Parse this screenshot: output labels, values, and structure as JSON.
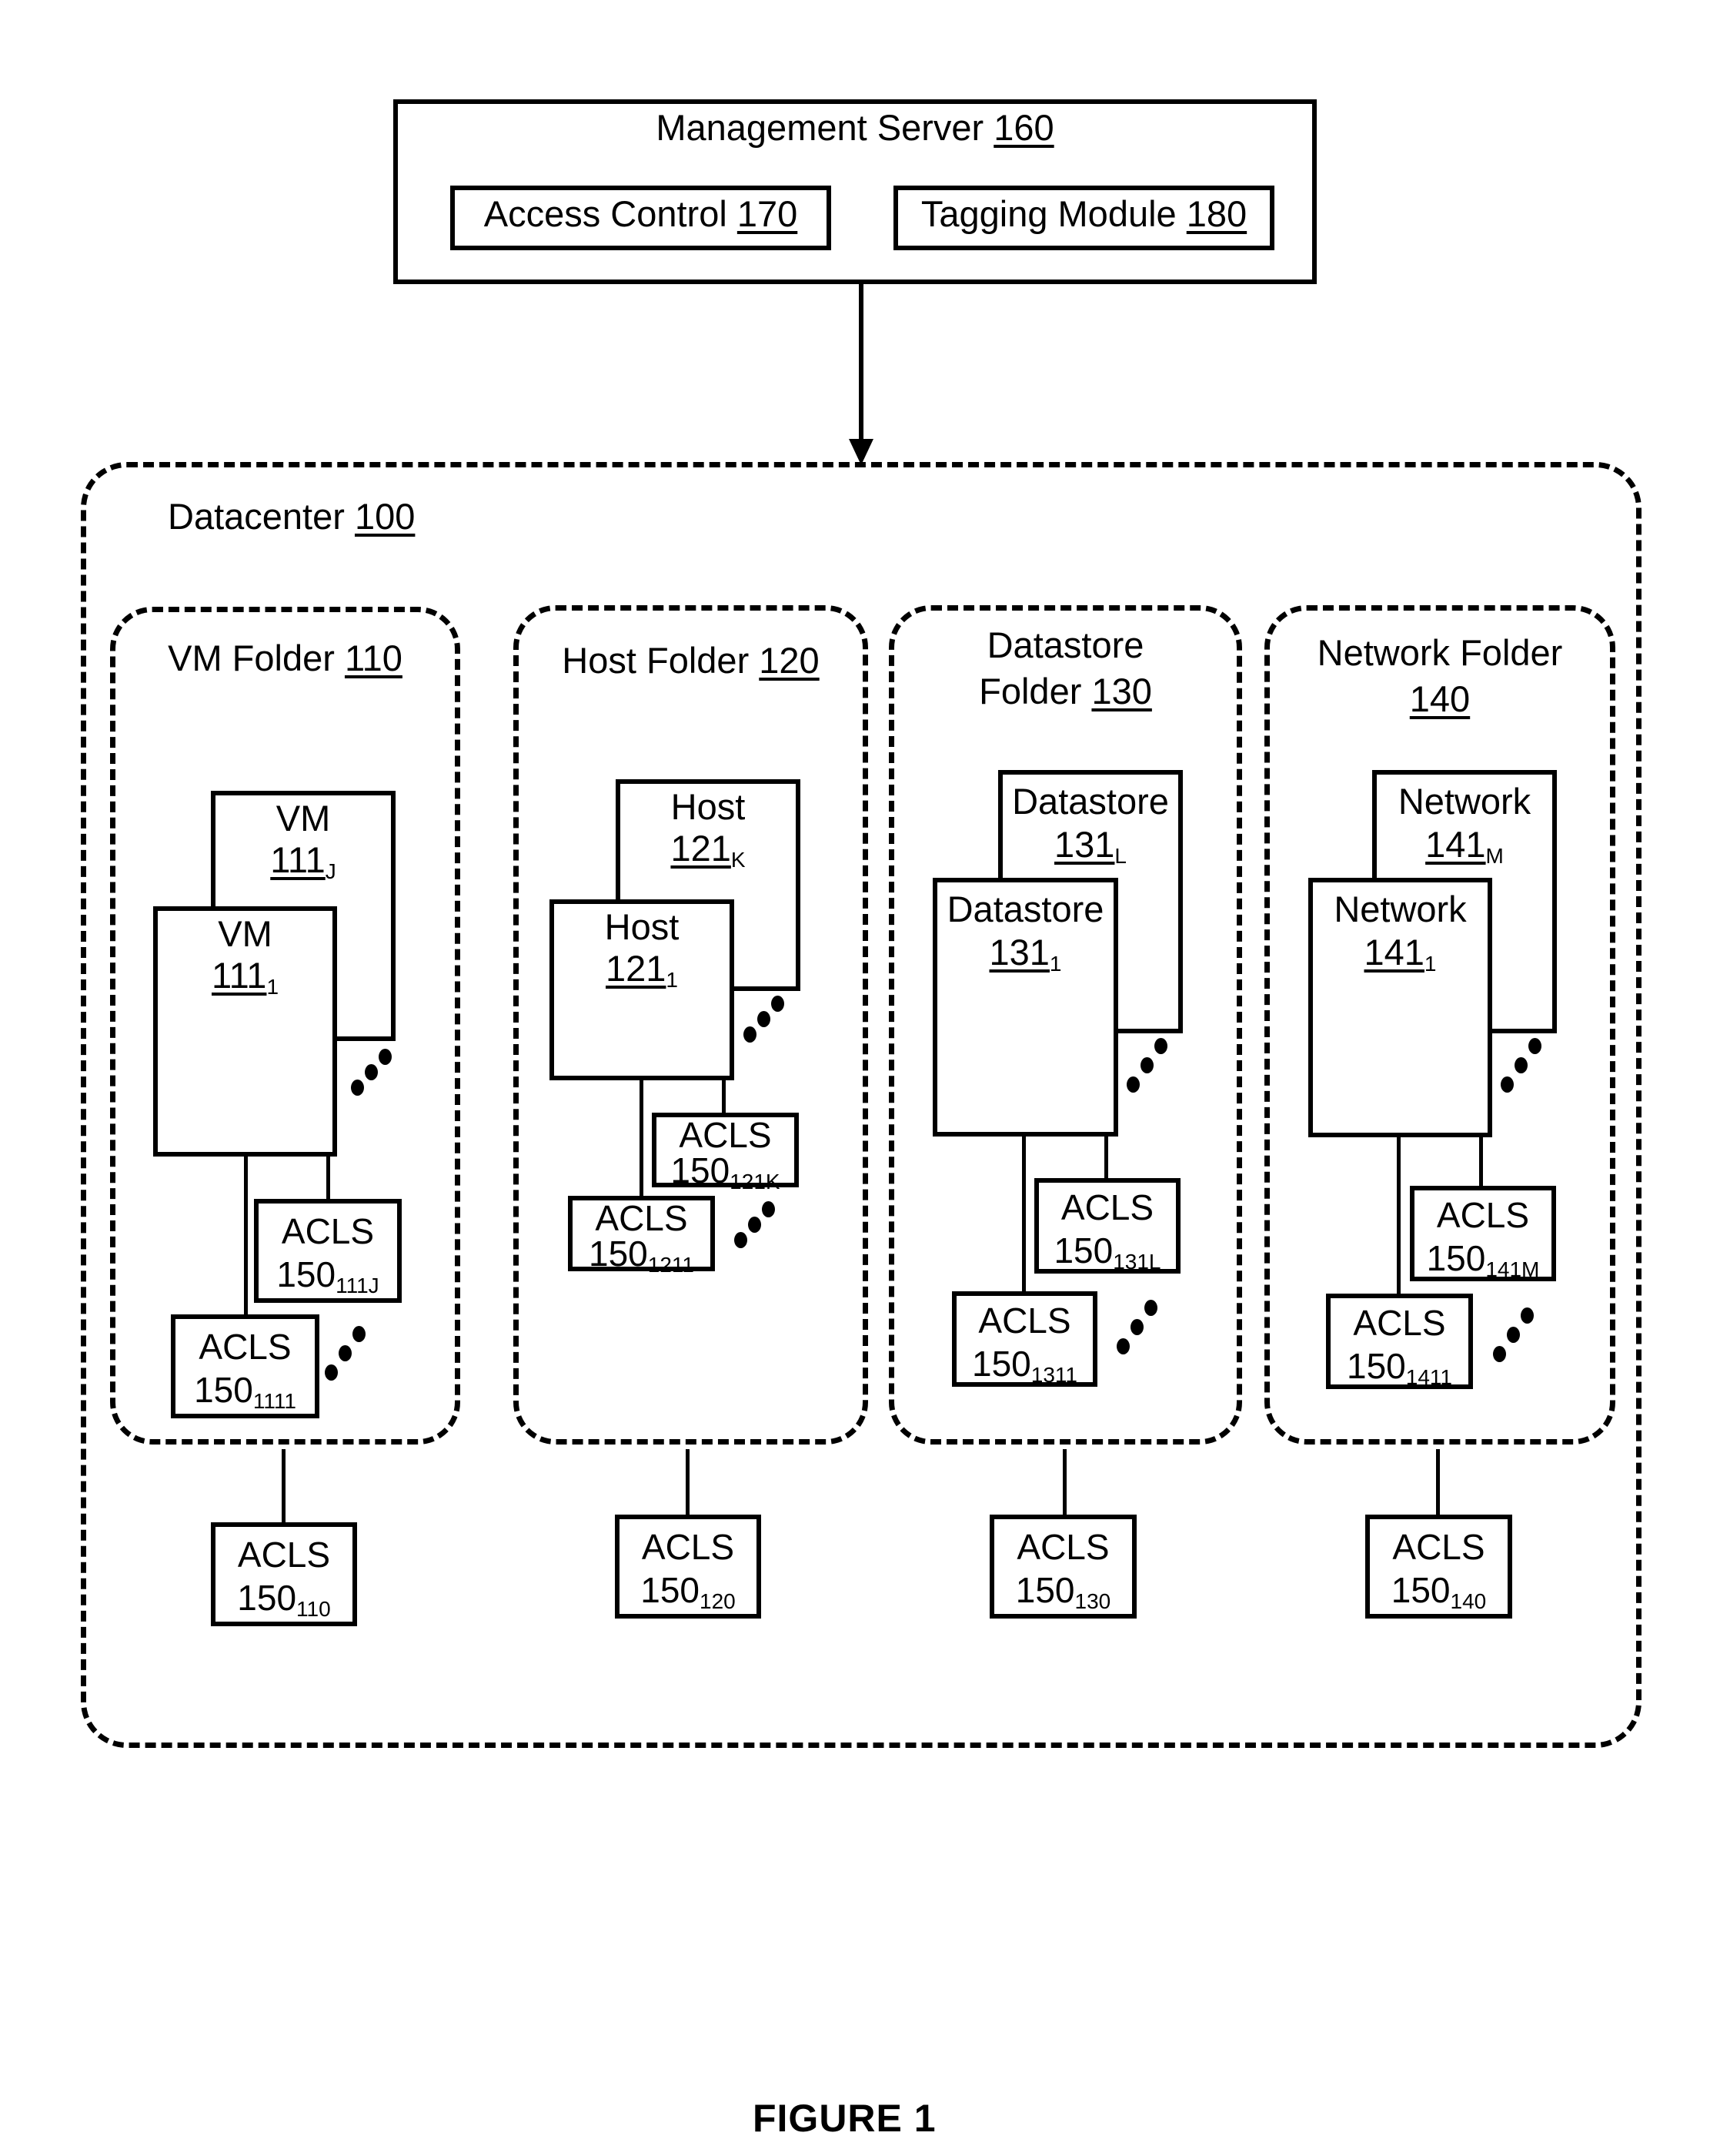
{
  "management_server": {
    "label": "Management Server",
    "ref": "160",
    "modules": [
      {
        "label": "Access Control",
        "ref": "170"
      },
      {
        "label": "Tagging Module",
        "ref": "180"
      }
    ]
  },
  "datacenter": {
    "label": "Datacenter",
    "ref": "100",
    "folders": [
      {
        "label_line1": "VM Folder",
        "label_line2": "",
        "ref": "110",
        "items": [
          {
            "name": "VM",
            "ref": "111",
            "sub": "J"
          },
          {
            "name": "VM",
            "ref": "111",
            "sub": "1"
          }
        ],
        "item_acls": [
          {
            "label": "ACLS",
            "ref": "150",
            "sub": "111J"
          },
          {
            "label": "ACLS",
            "ref": "150",
            "sub": "1111"
          }
        ],
        "folder_acls": {
          "label": "ACLS",
          "ref": "150",
          "sub": "110"
        }
      },
      {
        "label_line1": "Host Folder",
        "label_line2": "",
        "ref": "120",
        "items": [
          {
            "name": "Host",
            "ref": "121",
            "sub": "K"
          },
          {
            "name": "Host",
            "ref": "121",
            "sub": "1"
          }
        ],
        "item_acls": [
          {
            "label": "ACLS",
            "ref": "150",
            "sub": "121K"
          },
          {
            "label": "ACLS",
            "ref": "150",
            "sub": "1211"
          }
        ],
        "folder_acls": {
          "label": "ACLS",
          "ref": "150",
          "sub": "120"
        }
      },
      {
        "label_line1": "Datastore",
        "label_line2": "Folder",
        "ref": "130",
        "items": [
          {
            "name": "Datastore",
            "ref": "131",
            "sub": "L"
          },
          {
            "name": "Datastore",
            "ref": "131",
            "sub": "1"
          }
        ],
        "item_acls": [
          {
            "label": "ACLS",
            "ref": "150",
            "sub": "131L"
          },
          {
            "label": "ACLS",
            "ref": "150",
            "sub": "1311"
          }
        ],
        "folder_acls": {
          "label": "ACLS",
          "ref": "150",
          "sub": "130"
        }
      },
      {
        "label_line1": "Network Folder",
        "label_line2": "",
        "ref": "140",
        "items": [
          {
            "name": "Network",
            "ref": "141",
            "sub": "M"
          },
          {
            "name": "Network",
            "ref": "141",
            "sub": "1"
          }
        ],
        "item_acls": [
          {
            "label": "ACLS",
            "ref": "150",
            "sub": "141M"
          },
          {
            "label": "ACLS",
            "ref": "150",
            "sub": "1411"
          }
        ],
        "folder_acls": {
          "label": "ACLS",
          "ref": "150",
          "sub": "140"
        }
      }
    ]
  },
  "figure_label": "FIGURE 1"
}
